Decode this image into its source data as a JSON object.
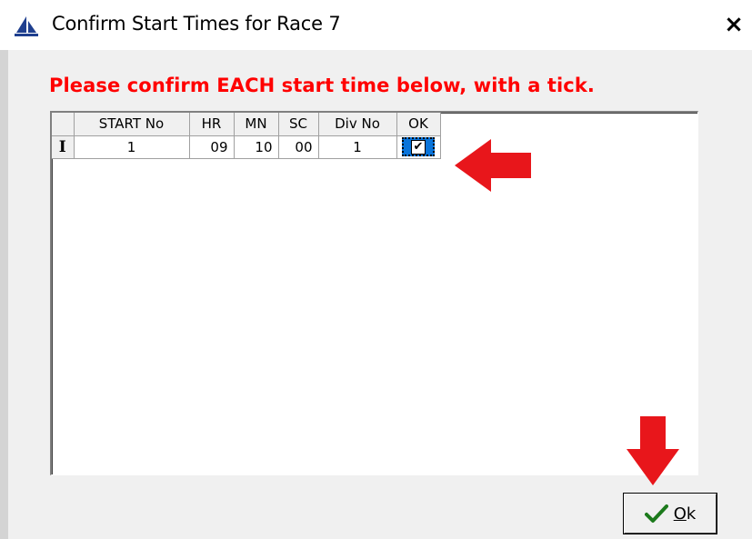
{
  "window": {
    "title": "Confirm Start Times for Race 7",
    "close_symbol": "×",
    "icon": "sailboat-icon"
  },
  "instruction": "Please confirm EACH start time below, with a tick.",
  "grid": {
    "columns": [
      "START No",
      "HR",
      "MN",
      "SC",
      "Div No",
      "OK"
    ],
    "rows": [
      {
        "indicator": "I",
        "start_no": "1",
        "hr": "09",
        "mn": "10",
        "sc": "00",
        "div_no": "1",
        "ok_checked": true,
        "ok_symbol": "✔"
      }
    ]
  },
  "buttons": {
    "ok_label_underlined": "O",
    "ok_label_rest": "k"
  },
  "annotations": {
    "arrow_color": "#e8161b"
  },
  "colors": {
    "instruction_text": "#ff0000",
    "selected_cell": "#0a74da",
    "check_green": "#1c7a1c"
  }
}
